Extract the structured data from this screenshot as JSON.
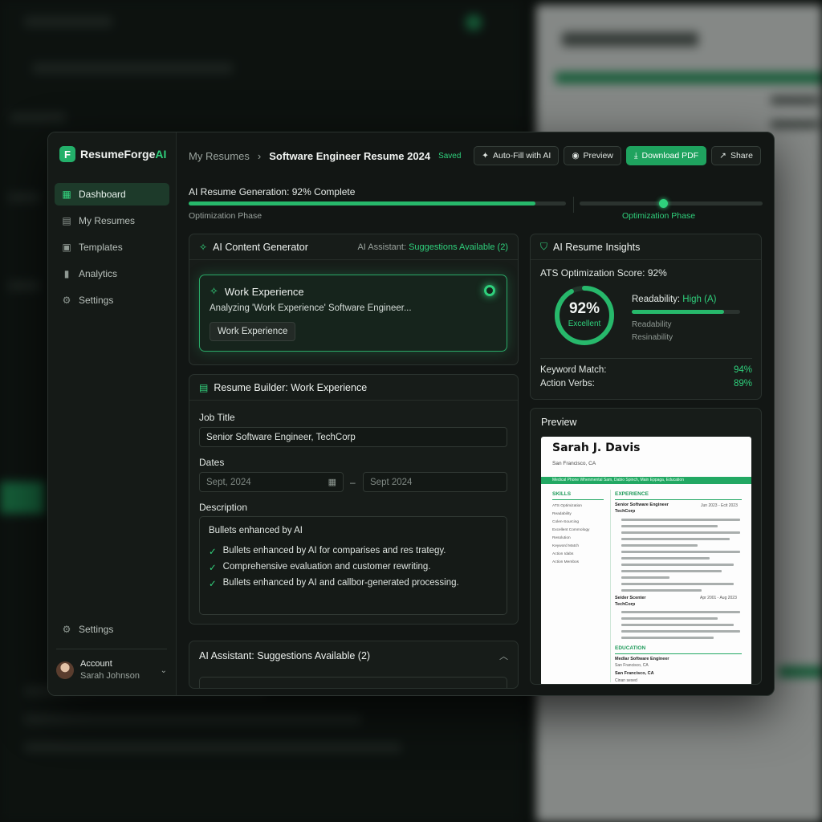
{
  "app": {
    "name_main": "ResumeForge",
    "name_accent": "AI",
    "logo_letter": "F"
  },
  "sidebar": {
    "items": [
      {
        "label": "Dashboard",
        "icon": "grid-icon"
      },
      {
        "label": "My Resumes",
        "icon": "document-icon"
      },
      {
        "label": "Templates",
        "icon": "layout-icon"
      },
      {
        "label": "Analytics",
        "icon": "bar-chart-icon"
      },
      {
        "label": "Settings",
        "icon": "gear-icon"
      }
    ],
    "bottom_settings": "Settings",
    "account_title": "Account",
    "account_name": "Sarah Johnson"
  },
  "header": {
    "crumb_parent": "My Resumes",
    "crumb_current": "Software Engineer Resume 2024",
    "saved": "Saved",
    "autofill": "Auto-Fill with AI",
    "preview": "Preview",
    "download": "Download PDF",
    "share": "Share"
  },
  "progress": {
    "title": "AI Resume Generation: 92% Complete",
    "value": 0.92,
    "phase_left": "Optimization Phase",
    "phase_right": "Optimization Phase"
  },
  "generator": {
    "title": "AI Content Generator",
    "assistant_prefix": "AI Assistant: ",
    "assistant_status": "Suggestions Available (2)",
    "box_title": "Work Experience",
    "box_sub": "Analyzing 'Work Experience' Software Engineer...",
    "box_tag": "Work Experience"
  },
  "builder": {
    "title": "Resume Builder: Work Experience",
    "job_label": "Job Title",
    "job_value": "Senior Software Engineer, TechCorp",
    "dates_label": "Dates",
    "date_start": "Sept, 2024",
    "date_end": "Sept 2024",
    "dash": "–",
    "desc_label": "Description",
    "desc_head": "Bullets enhanced by AI",
    "bullets": [
      "Bullets enhanced by AI for comparises and res trategy.",
      "Comprehensive evaluation and customer rewriting.",
      "Bullets enhanced by AI and callbor-generated processing."
    ]
  },
  "suggestions": {
    "title": "AI Assistant: Suggestions Available (2)"
  },
  "insights": {
    "title": "AI Resume Insights",
    "ats": "ATS Optimization Score: 92%",
    "score_value": "92%",
    "score_fraction": 0.92,
    "score_label": "Excellent",
    "readability_prefix": "Readability: ",
    "readability_value": "High (A)",
    "readability_fraction": 0.85,
    "read_sub1": "Readability",
    "read_sub2": "Resinability",
    "keyword_label": "Keyword Match:",
    "keyword_value": "94%",
    "verbs_label": "Action Verbs:",
    "verbs_value": "89%"
  },
  "preview": {
    "title": "Preview",
    "name": "Sarah J. Davis",
    "location": "San Francisco, CA",
    "band": "Medical Phone Whenmental Sam, Dabio Spinch, Main Eppaga, Education",
    "skills_title": "SKILLS",
    "skills": [
      "ATS Optimization",
      "Readability",
      "Colen-Sourcing",
      "Excellent Commology",
      "Resolution",
      "Keyword Match",
      "Action Idabs",
      "Action Membos"
    ],
    "experience_title": "EXPERIENCE",
    "job1_title": "Senior Software Engineer",
    "job1_company": "TechCorp",
    "job1_dates": "Jun 2023 - Ecit 2023",
    "job2_title": "Seider Scenter",
    "job2_company": "TechCorp",
    "job2_dates": "Apr 2001 - Aug 2023",
    "education_title": "EDUCATION",
    "edu_title": "Medlar Software Engineer",
    "edu_loc": "San Francisco, CA",
    "edu2_loc": "San Francisco, CA",
    "edu2_sub": "Cinan sexed"
  },
  "colors": {
    "accent": "#2fd07c",
    "primary_button": "#1fa35f",
    "background": "#121614"
  }
}
